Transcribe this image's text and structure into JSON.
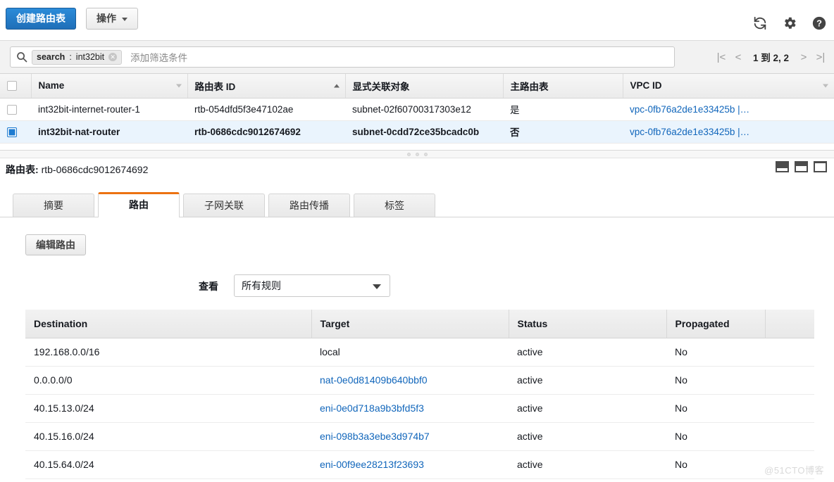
{
  "toolbar": {
    "create_label": "创建路由表",
    "actions_label": "操作",
    "icons": {
      "refresh": "refresh-icon",
      "settings": "gear-icon",
      "help": "help-icon"
    }
  },
  "filter": {
    "search_icon": "search-icon",
    "token_key": "search",
    "token_value": "int32bit",
    "token_separator": ":",
    "remove_icon": "remove-token-icon",
    "placeholder": "添加筛选条件",
    "pagination": {
      "first": "|<",
      "prev": "<",
      "text": "1 到 2,  2",
      "next": ">",
      "last": ">|"
    }
  },
  "list": {
    "columns": [
      {
        "label": "Name",
        "sort": "desc"
      },
      {
        "label": "路由表 ID",
        "sort": "asc"
      },
      {
        "label": "显式关联对象",
        "sort": "none"
      },
      {
        "label": "主路由表",
        "sort": "none"
      },
      {
        "label": "VPC ID",
        "sort": "desc"
      }
    ],
    "rows": [
      {
        "selected": false,
        "name": "int32bit-internet-router-1",
        "route_table_id": "rtb-054dfd5f3e47102ae",
        "association": "subnet-02f60700317303e12",
        "main": "是",
        "vpc_id": "vpc-0fb76a2de1e33425b |…"
      },
      {
        "selected": true,
        "name": "int32bit-nat-router",
        "route_table_id": "rtb-0686cdc9012674692",
        "association": "subnet-0cdd72ce35bcadc0b",
        "main": "否",
        "vpc_id": "vpc-0fb76a2de1e33425b |…"
      }
    ]
  },
  "detail": {
    "title_label": "路由表:",
    "title_value": "rtb-0686cdc9012674692",
    "panel_icons": [
      "panel-size-small-icon",
      "panel-size-medium-icon",
      "panel-size-large-icon"
    ],
    "tabs": [
      {
        "label": "摘要",
        "active": false
      },
      {
        "label": "路由",
        "active": true
      },
      {
        "label": "子网关联",
        "active": false
      },
      {
        "label": "路由传播",
        "active": false
      },
      {
        "label": "标签",
        "active": false
      }
    ],
    "edit_button": "编辑路由",
    "view_label": "查看",
    "view_selected": "所有规则",
    "routes_columns": [
      "Destination",
      "Target",
      "Status",
      "Propagated",
      ""
    ],
    "routes": [
      {
        "destination": "192.168.0.0/16",
        "target": "local",
        "target_link": false,
        "status": "active",
        "propagated": "No"
      },
      {
        "destination": "0.0.0.0/0",
        "target": "nat-0e0d81409b640bbf0",
        "target_link": true,
        "status": "active",
        "propagated": "No"
      },
      {
        "destination": "40.15.13.0/24",
        "target": "eni-0e0d718a9b3bfd5f3",
        "target_link": true,
        "status": "active",
        "propagated": "No"
      },
      {
        "destination": "40.15.16.0/24",
        "target": "eni-098b3a3ebe3d974b7",
        "target_link": true,
        "status": "active",
        "propagated": "No"
      },
      {
        "destination": "40.15.64.0/24",
        "target": "eni-00f9ee28213f23693",
        "target_link": true,
        "status": "active",
        "propagated": "No"
      }
    ]
  },
  "watermark": "@51CTO博客",
  "colors": {
    "primary_button": "#1f6fb8",
    "link": "#1166bb",
    "active_tab_accent": "#ec7211",
    "status_active": "#1d8102",
    "selected_row": "#eaf4fd",
    "checkbox_checked": "#1f7cd1"
  }
}
